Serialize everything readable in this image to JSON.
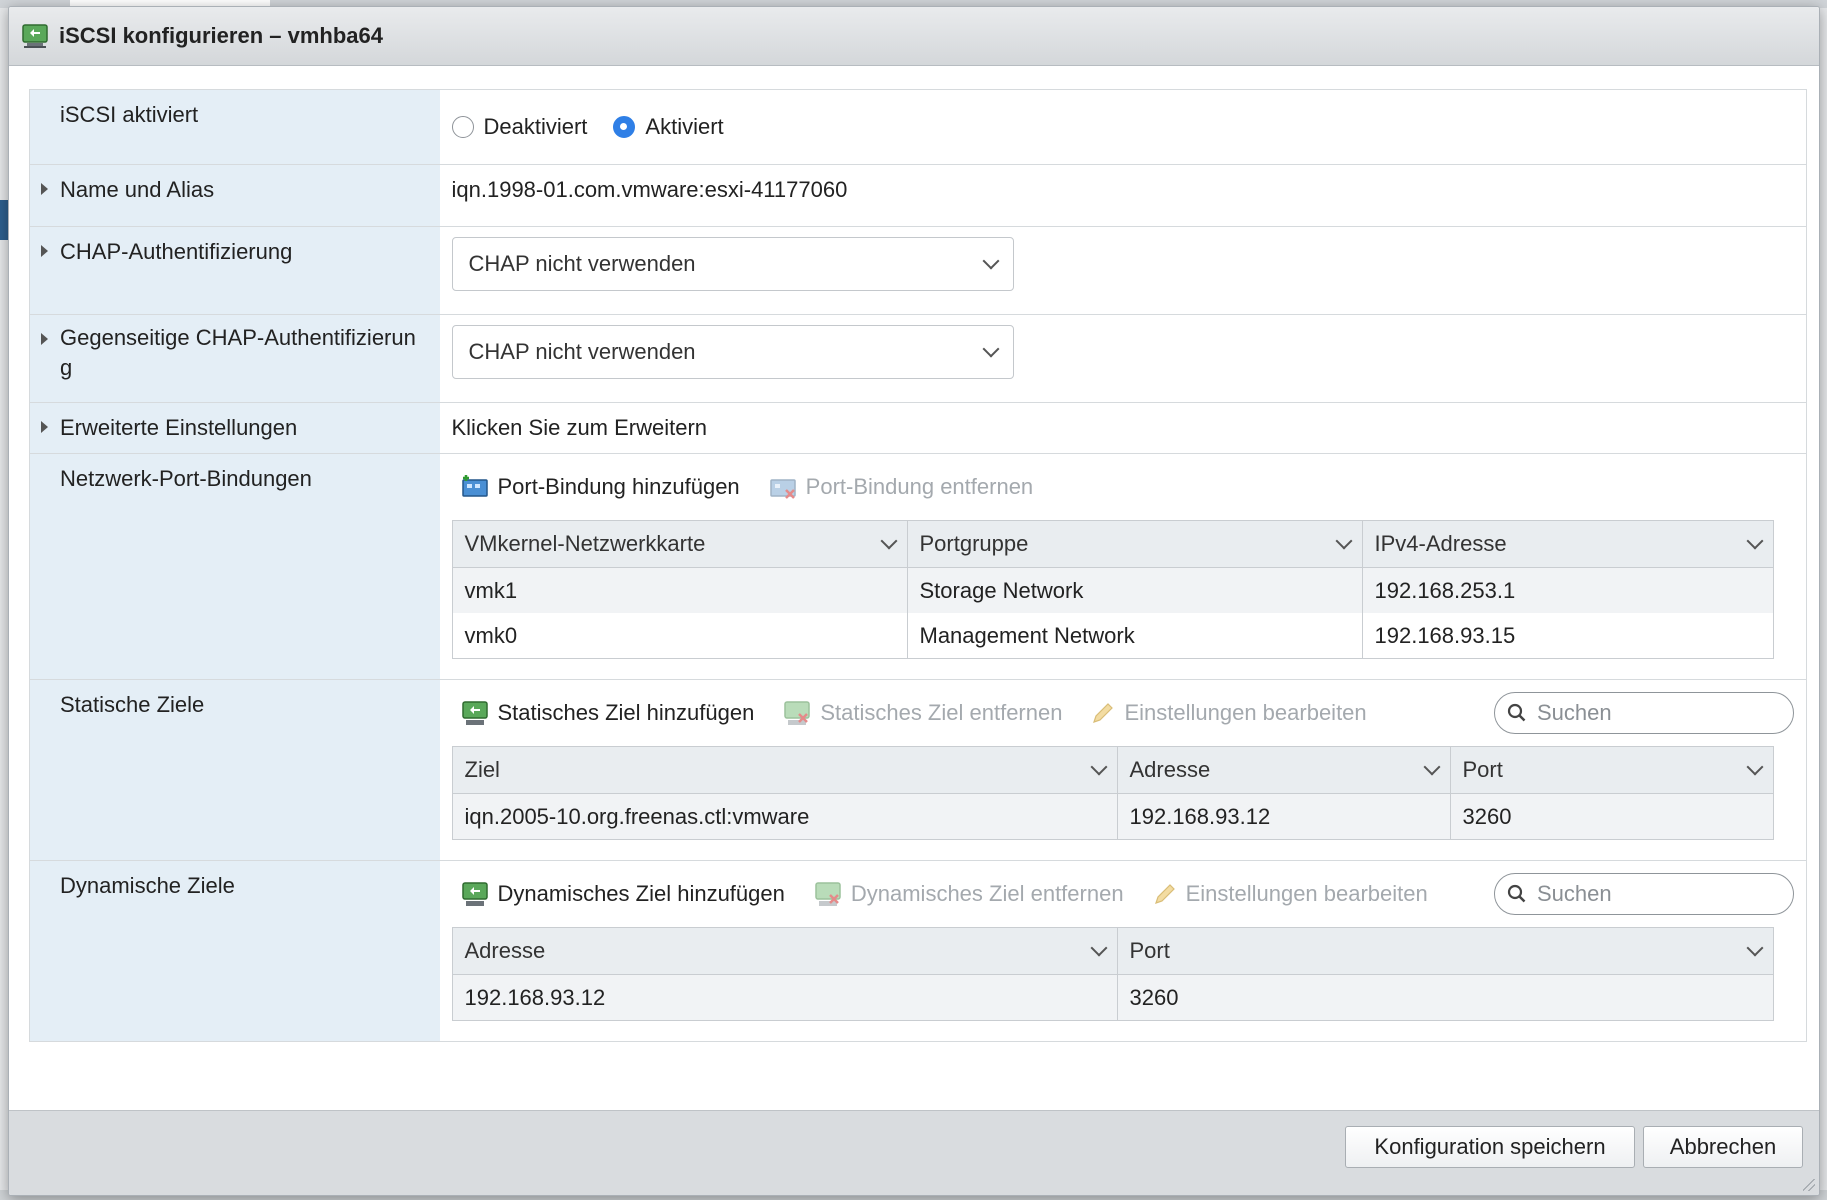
{
  "dialog": {
    "title": "iSCSI konfigurieren – vmhba64"
  },
  "iscsi_enabled": {
    "label": "iSCSI aktiviert",
    "options": [
      "Deaktiviert",
      "Aktiviert"
    ],
    "selected": "Aktiviert"
  },
  "name_alias": {
    "label": "Name und Alias",
    "value": "iqn.1998-01.com.vmware:esxi-41177060"
  },
  "chap": {
    "label": "CHAP-Authentifizierung",
    "value": "CHAP nicht verwenden"
  },
  "mutual_chap": {
    "label": "Gegenseitige CHAP-Authentifizierung",
    "value": "CHAP nicht verwenden"
  },
  "advanced": {
    "label": "Erweiterte Einstellungen",
    "value": "Klicken Sie zum Erweitern"
  },
  "port_bindings": {
    "label": "Netzwerk-Port-Bindungen",
    "add": "Port-Bindung hinzufügen",
    "remove": "Port-Bindung entfernen",
    "columns": [
      "VMkernel-Netzwerkkarte",
      "Portgruppe",
      "IPv4-Adresse"
    ],
    "rows": [
      [
        "vmk1",
        "Storage Network",
        "192.168.253.1"
      ],
      [
        "vmk0",
        "Management Network",
        "192.168.93.15"
      ]
    ]
  },
  "static_targets": {
    "label": "Statische Ziele",
    "add": "Statisches Ziel hinzufügen",
    "remove": "Statisches Ziel entfernen",
    "edit": "Einstellungen bearbeiten",
    "search_placeholder": "Suchen",
    "columns": [
      "Ziel",
      "Adresse",
      "Port"
    ],
    "rows": [
      [
        "iqn.2005-10.org.freenas.ctl:vmware",
        "192.168.93.12",
        "3260"
      ]
    ]
  },
  "dynamic_targets": {
    "label": "Dynamische Ziele",
    "add": "Dynamisches Ziel hinzufügen",
    "remove": "Dynamisches Ziel entfernen",
    "edit": "Einstellungen bearbeiten",
    "search_placeholder": "Suchen",
    "columns": [
      "Adresse",
      "Port"
    ],
    "rows": [
      [
        "192.168.93.12",
        "3260"
      ]
    ]
  },
  "footer": {
    "save": "Konfiguration speichern",
    "cancel": "Abbrechen"
  },
  "colors": {
    "accent": "#2f7fe6",
    "label_bg": "#e4eef6",
    "header_bg": "#e9edf0",
    "disabled_text": "#a4a9ae"
  }
}
